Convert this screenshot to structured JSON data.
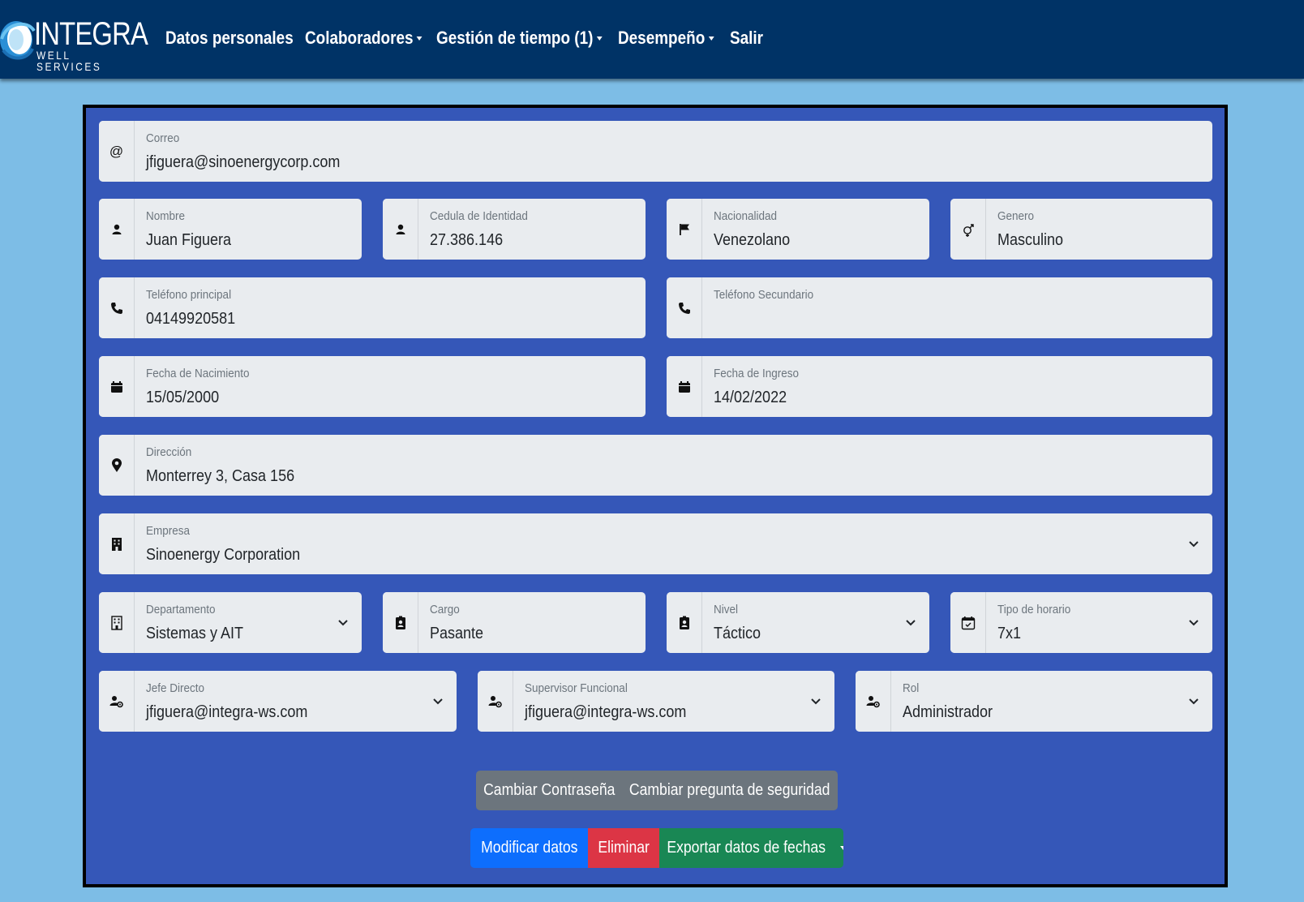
{
  "brand": {
    "name": "INTEGRA",
    "tagline": "WELL SERVICES"
  },
  "nav": [
    {
      "label": "Datos personales",
      "dropdown": false
    },
    {
      "label": "Colaboradores",
      "dropdown": true
    },
    {
      "label": "Gestión de tiempo (1)",
      "dropdown": true
    },
    {
      "label": "Desempeño",
      "dropdown": true
    },
    {
      "label": "Salir",
      "dropdown": false
    }
  ],
  "form": {
    "correo": {
      "label": "Correo",
      "value": "jfiguera@sinoenergycorp.com",
      "icon": "at-icon"
    },
    "nombre": {
      "label": "Nombre",
      "value": "Juan Figuera",
      "icon": "person-icon"
    },
    "cedula": {
      "label": "Cedula de Identidad",
      "value": "27.386.146",
      "icon": "person-icon"
    },
    "nacionalidad": {
      "label": "Nacionalidad",
      "value": "Venezolano",
      "icon": "flag-icon"
    },
    "genero": {
      "label": "Genero",
      "value": "Masculino",
      "icon": "gender-icon"
    },
    "telefono_principal": {
      "label": "Teléfono principal",
      "value": "04149920581",
      "icon": "phone-icon"
    },
    "telefono_secundario": {
      "label": "Teléfono Secundario",
      "value": "",
      "icon": "phone-icon"
    },
    "fecha_nacimiento": {
      "label": "Fecha de Nacimiento",
      "value": "15/05/2000",
      "icon": "calendar-icon"
    },
    "fecha_ingreso": {
      "label": "Fecha de Ingreso",
      "value": "14/02/2022",
      "icon": "calendar-icon"
    },
    "direccion": {
      "label": "Dirección",
      "value": "Monterrey 3, Casa 156",
      "icon": "location-pin-icon"
    },
    "empresa": {
      "label": "Empresa",
      "value": "Sinoenergy Corporation",
      "icon": "building-icon"
    },
    "departamento": {
      "label": "Departamento",
      "value": "Sistemas y AIT",
      "icon": "building-icon"
    },
    "cargo": {
      "label": "Cargo",
      "value": "Pasante",
      "icon": "badge-icon"
    },
    "nivel": {
      "label": "Nivel",
      "value": "Táctico",
      "icon": "badge-icon"
    },
    "tipo_horario": {
      "label": "Tipo de horario",
      "value": "7x1",
      "icon": "calendar-check-icon"
    },
    "jefe_directo": {
      "label": "Jefe Directo",
      "value": "jfiguera@integra-ws.com",
      "icon": "person-gear-icon"
    },
    "supervisor_funcional": {
      "label": "Supervisor Funcional",
      "value": "jfiguera@integra-ws.com",
      "icon": "person-gear-icon"
    },
    "rol": {
      "label": "Rol",
      "value": "Administrador",
      "icon": "person-gear-icon"
    }
  },
  "buttons": {
    "cambiar_contrasena": "Cambiar Contraseña",
    "cambiar_pregunta": "Cambiar pregunta de seguridad",
    "modificar": "Modificar datos",
    "eliminar": "Eliminar",
    "exportar": "Exportar datos de fechas"
  },
  "colors": {
    "navbar": "#003366",
    "page_background": "#7dbde6",
    "panel": "#3557b8",
    "primary": "#0d6efd",
    "danger": "#dc3545",
    "success": "#198754",
    "secondary": "#6c757d"
  }
}
